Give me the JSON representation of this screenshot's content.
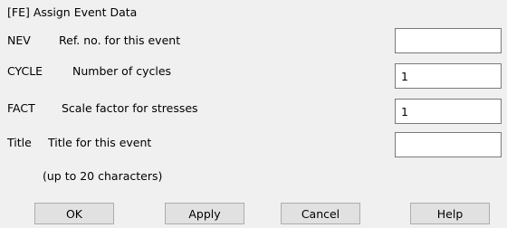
{
  "dialog": {
    "title": "[FE]  Assign Event Data"
  },
  "fields": [
    {
      "name": "NEV",
      "desc": "Ref. no. for this event",
      "value": ""
    },
    {
      "name": "CYCLE",
      "desc": "Number of cycles",
      "value": "1"
    },
    {
      "name": "FACT",
      "desc": "Scale factor for stresses",
      "value": "1"
    },
    {
      "name": "Title",
      "desc": "Title for this event",
      "value": ""
    }
  ],
  "note": "(up to 20 characters)",
  "buttons": {
    "ok": "OK",
    "apply": "Apply",
    "cancel": "Cancel",
    "help": "Help"
  }
}
